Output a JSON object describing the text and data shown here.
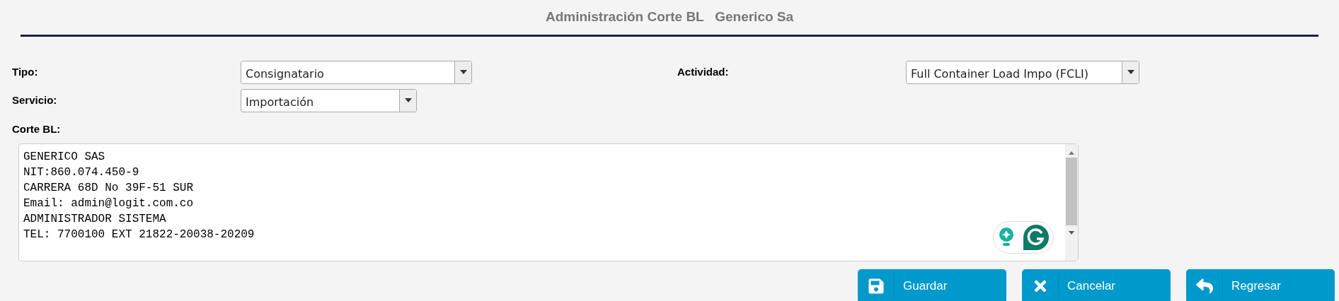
{
  "title": "Administración Corte BL   Generico Sa",
  "fields": [
    {
      "label": "Tipo:",
      "value": "Consignatario"
    },
    {
      "label": "Actividad:",
      "value": "Full Container Load Impo (FCLI)"
    },
    {
      "label": "Servicio:",
      "value": "Importación"
    }
  ],
  "corte_bl": {
    "label": "Corte BL:",
    "lines": [
      "GENERICO SAS",
      "NIT:860.074.450-9",
      "CARRERA 68D No 39F-51 SUR",
      "Email: admin@logit.com.co",
      "ADMINISTRADOR SISTEMA",
      "TEL: 7700100 EXT 21822-20038-20209"
    ]
  },
  "buttons": [
    {
      "kind": "save",
      "label": "Guardar"
    },
    {
      "kind": "cancel",
      "label": "Cancelar"
    },
    {
      "kind": "back",
      "label": "Regresar"
    }
  ]
}
